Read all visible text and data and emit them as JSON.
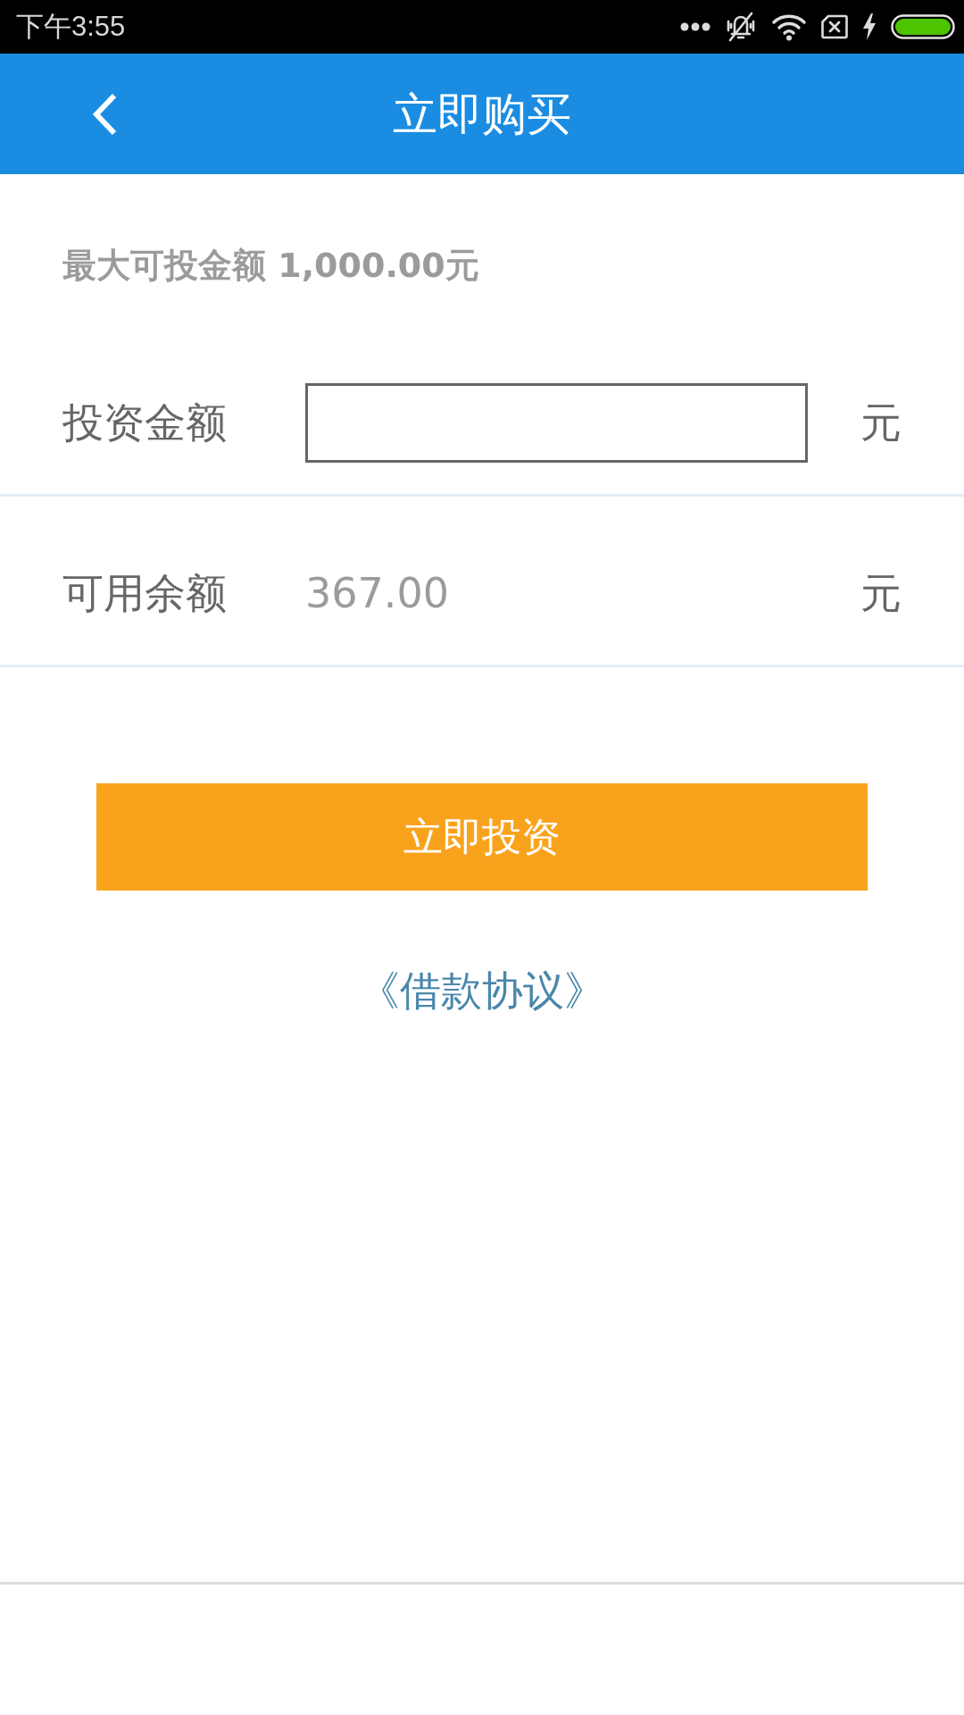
{
  "status_bar": {
    "time": "下午3:55"
  },
  "header": {
    "title": "立即购买"
  },
  "max_amount": "最大可投金额 1,000.00元",
  "form": [
    {
      "kind": "input",
      "label": "投资金额",
      "unit": "元"
    },
    {
      "kind": "text",
      "label": "可用余额",
      "value": "367.00",
      "unit": "元"
    }
  ],
  "submit_button": "立即投资",
  "agreement_link": "《借款协议》"
}
